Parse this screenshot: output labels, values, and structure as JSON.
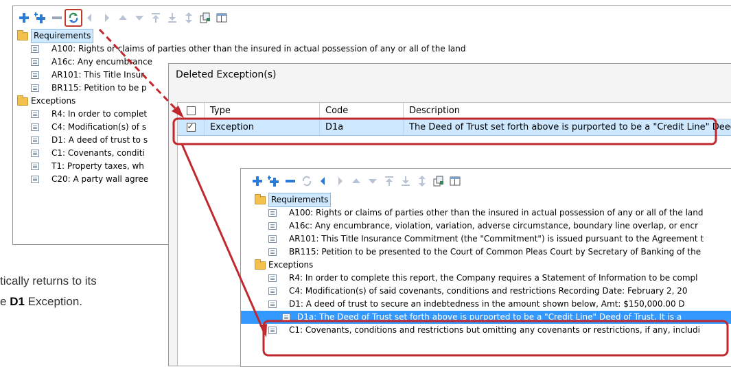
{
  "back_window": {
    "tree": [
      {
        "type": "folder",
        "label": "Requirements",
        "highlight": true
      },
      {
        "type": "item",
        "label": "A100: Rights or claims of parties other than the insured in actual possession of any or all of the land"
      },
      {
        "type": "item",
        "label": "A16c: Any encumbrance"
      },
      {
        "type": "item",
        "label": "AR101: This Title Insur"
      },
      {
        "type": "item",
        "label": "BR115: Petition to be p"
      },
      {
        "type": "folder",
        "label": "Exceptions"
      },
      {
        "type": "item",
        "label": "R4: In order to complet"
      },
      {
        "type": "item",
        "label": "C4: Modification(s) of s"
      },
      {
        "type": "item",
        "label": "D1: A deed of trust to s"
      },
      {
        "type": "item",
        "label": "C1: Covenants, conditi"
      },
      {
        "type": "item",
        "label": "T1: Property taxes, wh"
      },
      {
        "type": "item",
        "label": "C20: A party wall agree"
      }
    ]
  },
  "dialog": {
    "title": "Deleted Exception(s)",
    "columns": [
      "Type",
      "Code",
      "Description"
    ],
    "rows": [
      {
        "checked": true,
        "type": "Exception",
        "code": "D1a",
        "description": "The Deed of Trust set forth above is purported to be a \"Credit Line\" Deed of"
      }
    ]
  },
  "front_window": {
    "tree": [
      {
        "type": "folder",
        "label": "Requirements",
        "highlight": true
      },
      {
        "type": "item",
        "label": "A100: Rights or claims of parties other than the insured in actual possession of any or all of the land"
      },
      {
        "type": "item",
        "label": "A16c: Any encumbrance, violation, variation, adverse circumstance, boundary line overlap, or encr"
      },
      {
        "type": "item",
        "label": "AR101: This Title Insurance Commitment (the \"Commitment\") is issued pursuant to the Agreement t"
      },
      {
        "type": "item",
        "label": "BR115: Petition to be presented to the Court of Common Pleas Court by Secretary of Banking of the"
      },
      {
        "type": "folder",
        "label": "Exceptions"
      },
      {
        "type": "item",
        "label": "R4: In order to complete this report, the Company requires a Statement of Information to be compl"
      },
      {
        "type": "item",
        "label": "C4: Modification(s) of said covenants, conditions and restrictions   Recording Date:  February 2, 20"
      },
      {
        "type": "item",
        "label": "D1: A deed of trust to secure an indebtedness in the amount shown below,   Amt: $150,000.00  D"
      },
      {
        "type": "subitem",
        "label": "D1a: The Deed of Trust set forth above is purported to be a \"Credit Line\" Deed of Trust.  It is a",
        "selected": true
      },
      {
        "type": "item",
        "label": "C1: Covenants, conditions and restrictions but omitting any covenants or restrictions, if any, includi"
      }
    ]
  },
  "caption": {
    "line1": "tically returns to its",
    "line2_prefix": "e ",
    "line2_bold": "D1",
    "line2_suffix": " Exception."
  },
  "colors": {
    "callout": "#c0282d",
    "selection": "#3399ff",
    "highlight": "#cde8ff"
  }
}
